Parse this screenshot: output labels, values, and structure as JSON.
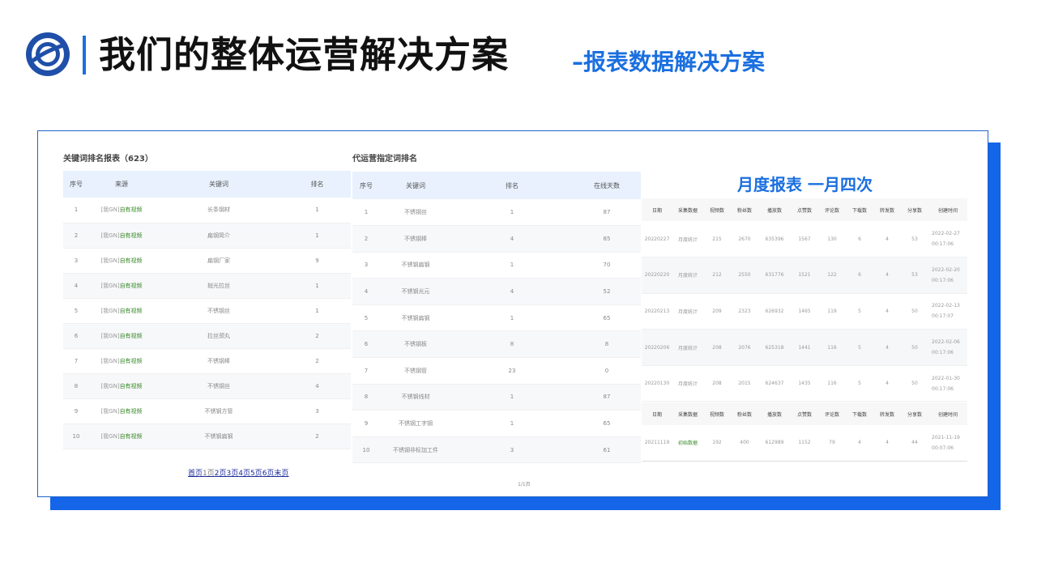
{
  "header": {
    "title": "我们的整体运营解决方案",
    "subtitle": "–报表数据解决方案"
  },
  "colors": {
    "accent": "#1a6fe0",
    "shadow": "#1565e8",
    "source_green": "#3a8a2a",
    "header_bg": "#e8f1fd"
  },
  "keyword_panel": {
    "title": "关键词排名报表（623）",
    "columns": [
      "序号",
      "来源",
      "关键词",
      "排名"
    ],
    "rows": [
      {
        "no": "1",
        "src_prefix": "[我GN]",
        "src": "自有视频",
        "kw": "长条钢材",
        "rank": "1"
      },
      {
        "no": "2",
        "src_prefix": "[我GN]",
        "src": "自有视频",
        "kw": "扁钢简介",
        "rank": "1"
      },
      {
        "no": "3",
        "src_prefix": "[我GN]",
        "src": "自有视频",
        "kw": "扁钢厂家",
        "rank": "9"
      },
      {
        "no": "4",
        "src_prefix": "[我GN]",
        "src": "自有视频",
        "kw": "抛光拉丝",
        "rank": "1"
      },
      {
        "no": "5",
        "src_prefix": "[我GN]",
        "src": "自有视频",
        "kw": "不锈钢丝",
        "rank": "1"
      },
      {
        "no": "6",
        "src_prefix": "[我GN]",
        "src": "自有视频",
        "kw": "拉丝颈丸",
        "rank": "2"
      },
      {
        "no": "7",
        "src_prefix": "[我GN]",
        "src": "自有视频",
        "kw": "不锈钢棒",
        "rank": "2"
      },
      {
        "no": "8",
        "src_prefix": "[我GN]",
        "src": "自有视频",
        "kw": "不锈钢丝",
        "rank": "4"
      },
      {
        "no": "9",
        "src_prefix": "[我GN]",
        "src": "自有视频",
        "kw": "不锈钢方管",
        "rank": "3"
      },
      {
        "no": "10",
        "src_prefix": "[我GN]",
        "src": "自有视频",
        "kw": "不锈钢扁钢",
        "rank": "2"
      }
    ],
    "pager": {
      "first": "首页",
      "p1": "1页",
      "p2": "2页",
      "p3": "3页",
      "p4": "4页",
      "p5": "5页",
      "p6": "6页",
      "last": "末页"
    }
  },
  "operation_panel": {
    "title": "代运营指定词排名",
    "columns": [
      "序号",
      "关键词",
      "排名",
      "在线天数"
    ],
    "rows": [
      {
        "no": "1",
        "kw": "不锈钢丝",
        "rank": "1",
        "days": "87"
      },
      {
        "no": "2",
        "kw": "不锈钢棒",
        "rank": "4",
        "days": "85"
      },
      {
        "no": "3",
        "kw": "不锈钢扁钢",
        "rank": "1",
        "days": "70"
      },
      {
        "no": "4",
        "kw": "不锈钢光元",
        "rank": "4",
        "days": "52"
      },
      {
        "no": "5",
        "kw": "不锈钢扁钢",
        "rank": "1",
        "days": "65"
      },
      {
        "no": "6",
        "kw": "不锈钢板",
        "rank": "8",
        "days": "8"
      },
      {
        "no": "7",
        "kw": "不锈钢管",
        "rank": "23",
        "days": "0"
      },
      {
        "no": "8",
        "kw": "不锈钢线材",
        "rank": "1",
        "days": "87"
      },
      {
        "no": "9",
        "kw": "不锈钢工字钢",
        "rank": "1",
        "days": "65"
      },
      {
        "no": "10",
        "kw": "不锈钢非标加工件",
        "rank": "3",
        "days": "61"
      }
    ],
    "page_info": "1/1页"
  },
  "monthly_panel": {
    "title": "月度报表  一月四次",
    "columns": [
      "日期",
      "采集数据",
      "视频数",
      "粉丝数",
      "播放数",
      "点赞数",
      "评论数",
      "下载数",
      "转发数",
      "分享数",
      "创建时间"
    ],
    "rows": [
      {
        "date": "20220227",
        "type": "月度统计",
        "videos": "215",
        "fans": "2670",
        "plays": "635396",
        "likes": "1567",
        "comments": "130",
        "downloads": "6",
        "forwards": "4",
        "shares": "53",
        "created": "2022-02-27 00:17:06"
      },
      {
        "date": "20220220",
        "type": "月度统计",
        "videos": "212",
        "fans": "2550",
        "plays": "631776",
        "likes": "1521",
        "comments": "122",
        "downloads": "6",
        "forwards": "4",
        "shares": "53",
        "created": "2022-02-20 00:17:06"
      },
      {
        "date": "20220213",
        "type": "月度统计",
        "videos": "209",
        "fans": "2323",
        "plays": "626932",
        "likes": "1465",
        "comments": "119",
        "downloads": "5",
        "forwards": "4",
        "shares": "50",
        "created": "2022-02-13 00:17:07"
      },
      {
        "date": "20220206",
        "type": "月度统计",
        "videos": "208",
        "fans": "2076",
        "plays": "625318",
        "likes": "1441",
        "comments": "116",
        "downloads": "5",
        "forwards": "4",
        "shares": "50",
        "created": "2022-02-06 00:17:06"
      },
      {
        "date": "20220130",
        "type": "月度统计",
        "videos": "208",
        "fans": "2015",
        "plays": "624637",
        "likes": "1435",
        "comments": "116",
        "downloads": "5",
        "forwards": "4",
        "shares": "50",
        "created": "2022-01-30 00:17:06"
      }
    ],
    "initial": {
      "columns": [
        "日期",
        "采集数据",
        "视频数",
        "粉丝数",
        "播放数",
        "点赞数",
        "评论数",
        "下载数",
        "转发数",
        "分享数",
        "创建时间"
      ],
      "row": {
        "date": "20211119",
        "type": "初始数据",
        "videos": "192",
        "fans": "400",
        "plays": "612989",
        "likes": "1152",
        "comments": "79",
        "downloads": "4",
        "forwards": "4",
        "shares": "44",
        "created": "2021-11-19 00:07:06"
      }
    }
  }
}
